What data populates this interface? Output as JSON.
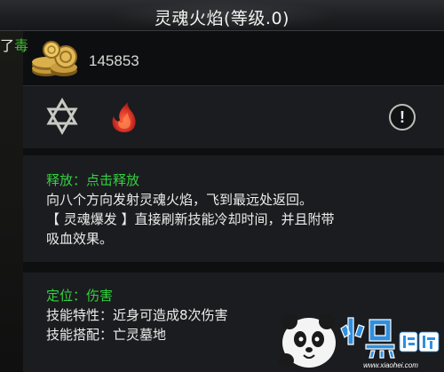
{
  "title": "灵魂火焰(等级.0)",
  "background_chat": {
    "prefix": "了",
    "highlight": "毒"
  },
  "currency": {
    "icon": "gold-coins-icon",
    "value": "145853"
  },
  "skill_icons": {
    "element_icon": "hexagram-star-icon",
    "type_icon": "flame-icon",
    "info_button_label": "!"
  },
  "release": {
    "label": "释放：点击释放",
    "line1": "向八个方向发射灵魂火焰，飞到最远处返回。",
    "line2": "【 灵魂爆发 】直接刷新技能冷却时间，并且附带",
    "line3": "吸血效果。"
  },
  "positioning": {
    "label": "定位：伤害",
    "trait": "技能特性：近身可造成8次伤害",
    "combo": "技能搭配：亡灵墓地"
  },
  "watermark": {
    "brand": "小黑游戏",
    "url": "www.xiaohei.com"
  },
  "colors": {
    "accent_green": "#33d13f",
    "flame_red": "#d63226"
  }
}
